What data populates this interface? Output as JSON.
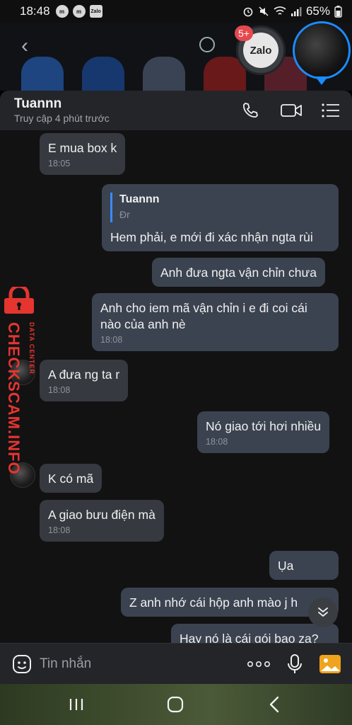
{
  "status_bar": {
    "time": "18:48",
    "battery": "65%",
    "notif_icon_label": "Zalo"
  },
  "chat_heads": {
    "zalo_label": "Zalo",
    "badge": "5+"
  },
  "header": {
    "contact_name": "Tuannn",
    "last_seen": "Truy cập 4 phút trước"
  },
  "messages": [
    {
      "text": "E mua box k",
      "time": "18:05",
      "direction": "in"
    },
    {
      "quote_name": "Tuannn",
      "quote_text": "Đr",
      "text": "Hem phải, e mới đi xác nhận ngta rùi",
      "direction": "out"
    },
    {
      "text": "Anh đưa ngta vận chỉn chưa",
      "direction": "out"
    },
    {
      "text": "Anh cho iem mã vận chỉn i e đi coi cái nào của anh nè",
      "time": "18:08",
      "direction": "out"
    },
    {
      "text": "A đưa ng ta r",
      "time": "18:08",
      "direction": "in"
    },
    {
      "text": "Nó giao tới hơi nhiều",
      "time": "18:08",
      "direction": "out"
    },
    {
      "text": "K có mã",
      "direction": "in"
    },
    {
      "text": "A giao bưu điện mà",
      "time": "18:08",
      "direction": "in"
    },
    {
      "text": "Ụa",
      "direction": "out"
    },
    {
      "text": "Z anh nhớ cái hộp anh mào j h",
      "direction": "out"
    },
    {
      "text": "Hay nó là cái gói bao za?",
      "direction": "out"
    }
  ],
  "watermark": {
    "main": "CHECKSCAM.INFO",
    "sub": "DATA CENTER"
  },
  "input": {
    "placeholder": "Tin nhắn"
  },
  "colors": {
    "accent": "#1a8cff",
    "bubble_in": "#36393f",
    "bubble_out": "#3b4350",
    "watermark": "#e5352f",
    "badge": "#e5484d"
  }
}
